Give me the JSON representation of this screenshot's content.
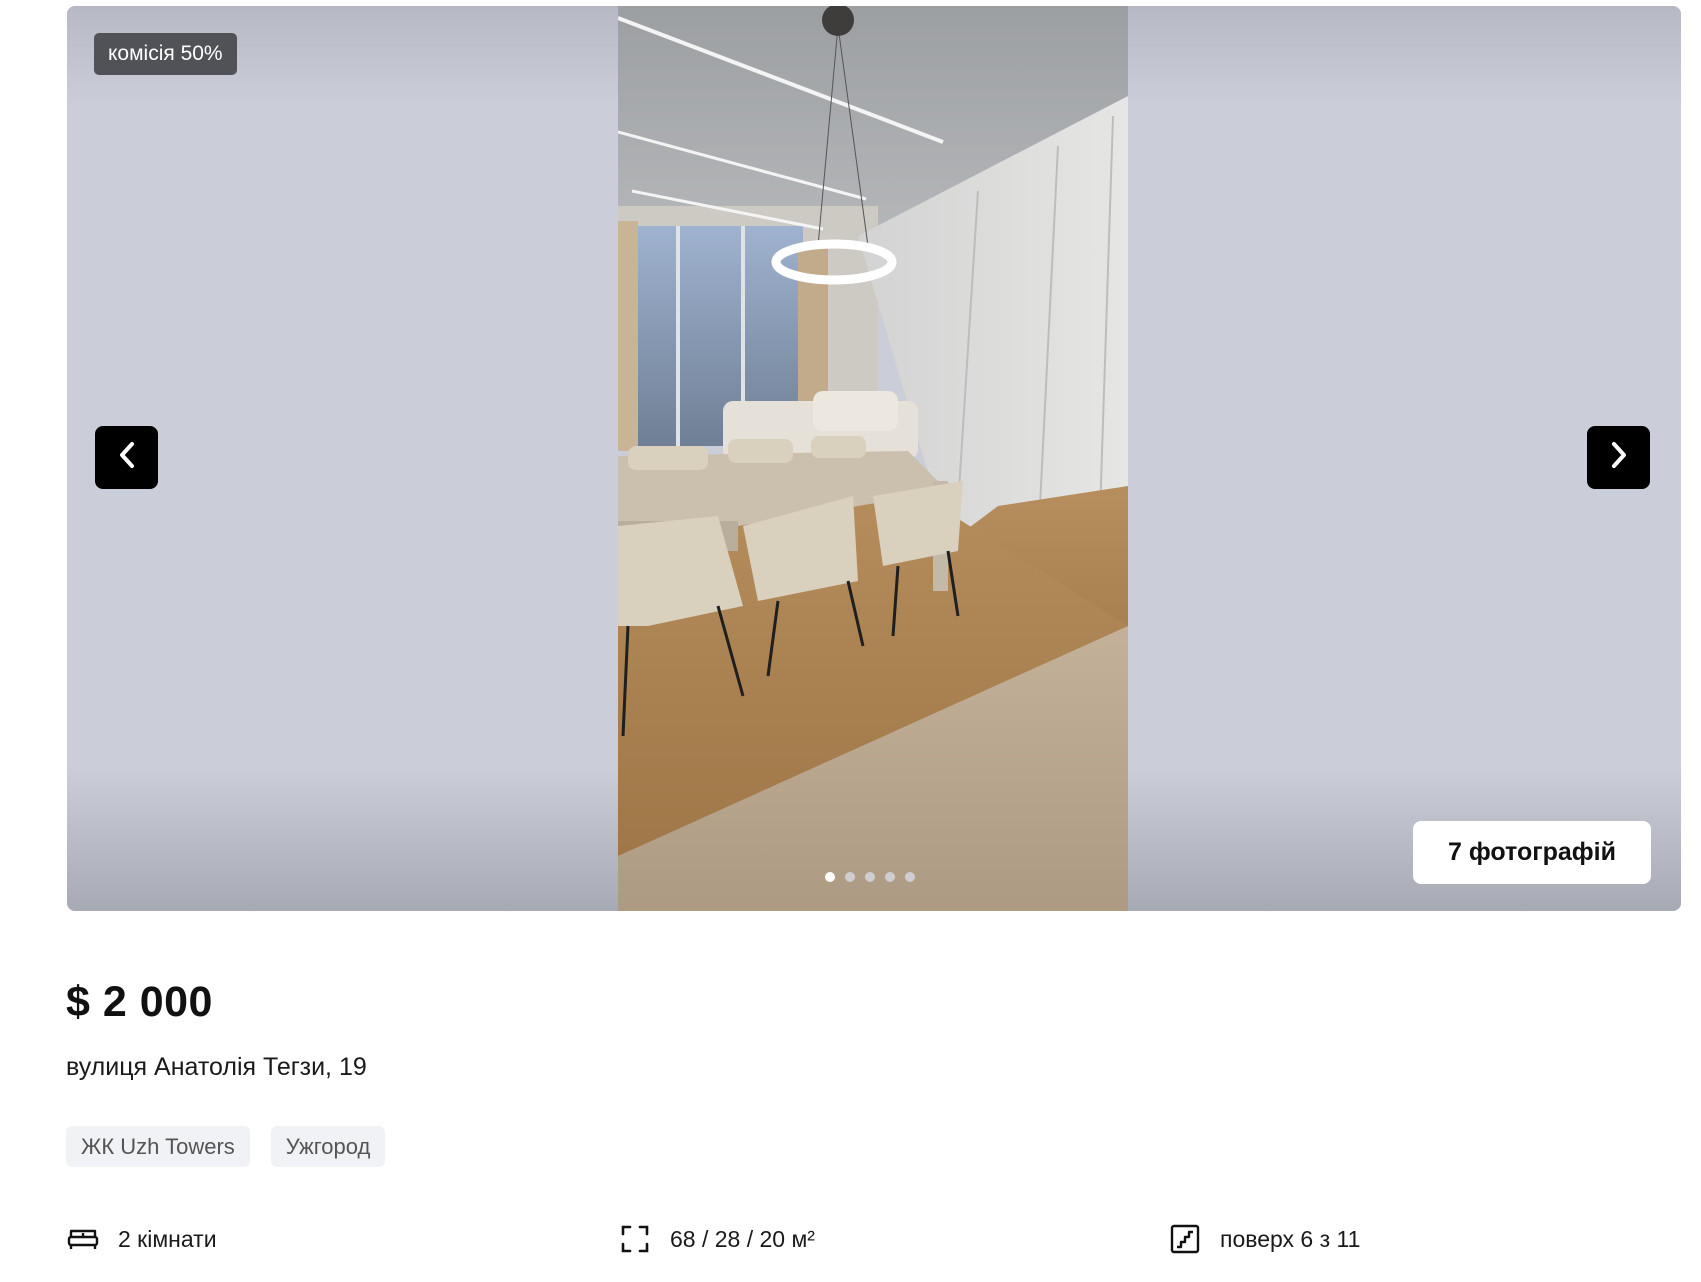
{
  "gallery": {
    "badge": "комісія 50%",
    "photos_button": "7 фотографій",
    "dots_total": 5,
    "dots_active_index": 0,
    "prev_icon": "chevron-left-icon",
    "next_icon": "chevron-right-icon"
  },
  "listing": {
    "price": "$ 2 000",
    "address": "вулиця Анатолія Тегзи, 19",
    "tags": [
      "ЖК Uzh Towers",
      "Ужгород"
    ]
  },
  "features": {
    "rooms": {
      "icon": "bed-icon",
      "text": "2 кімнати"
    },
    "area": {
      "icon": "area-icon",
      "text": "68 / 28 / 20 м²"
    },
    "floor": {
      "icon": "stairs-icon",
      "text": "поверх 6 з 11"
    }
  }
}
